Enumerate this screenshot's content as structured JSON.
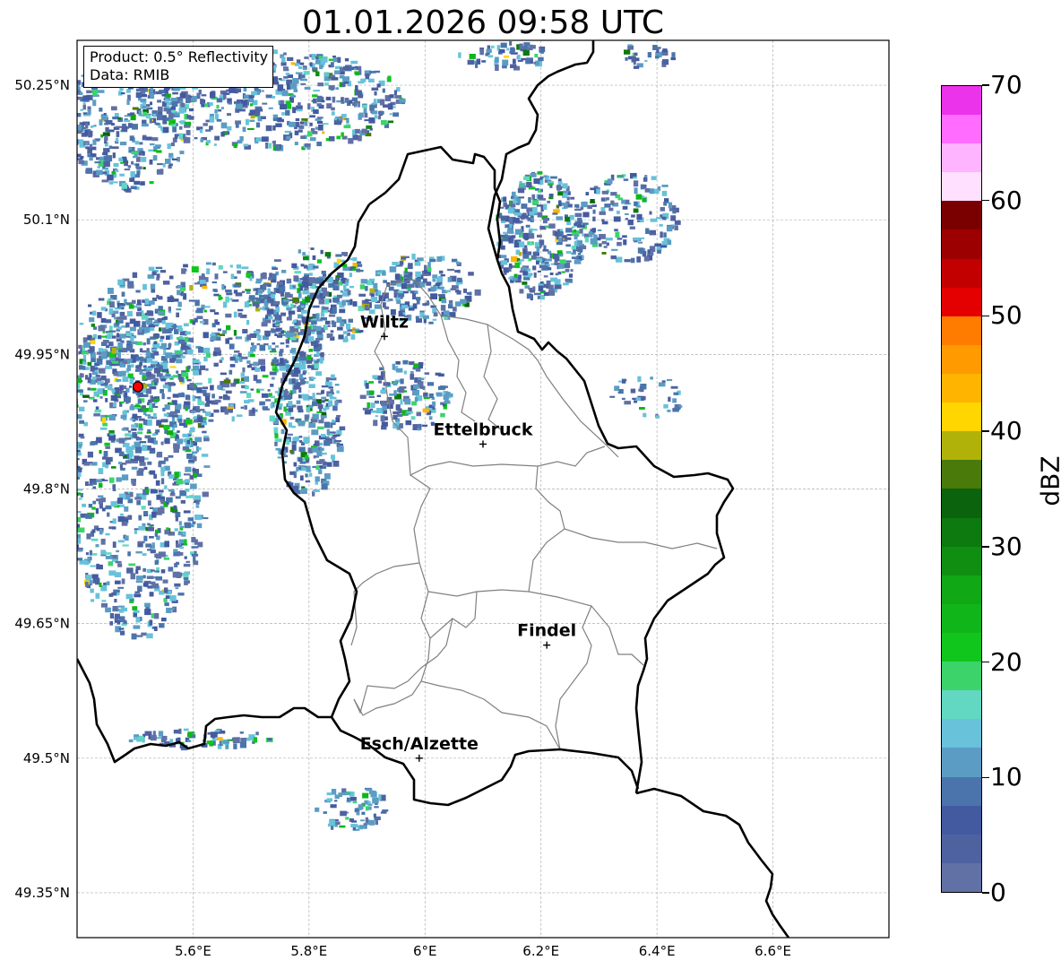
{
  "title": "01.01.2026 09:58 UTC",
  "info": {
    "product": "Product: 0.5° Reflectivity",
    "data": "Data: RMIB"
  },
  "map": {
    "lon_range": [
      5.4,
      6.8
    ],
    "lat_range": [
      49.3,
      50.3
    ],
    "lon_ticks": [
      {
        "value": 5.6,
        "label": "5.6°E"
      },
      {
        "value": 5.8,
        "label": "5.8°E"
      },
      {
        "value": 6.0,
        "label": "6°E"
      },
      {
        "value": 6.2,
        "label": "6.2°E"
      },
      {
        "value": 6.4,
        "label": "6.4°E"
      },
      {
        "value": 6.6,
        "label": "6.6°E"
      }
    ],
    "lat_ticks": [
      {
        "value": 49.35,
        "label": "49.35°N"
      },
      {
        "value": 49.5,
        "label": "49.5°N"
      },
      {
        "value": 49.65,
        "label": "49.65°N"
      },
      {
        "value": 49.8,
        "label": "49.8°N"
      },
      {
        "value": 49.95,
        "label": "49.95°N"
      },
      {
        "value": 50.1,
        "label": "50.1°N"
      },
      {
        "value": 50.25,
        "label": "50.25°N"
      }
    ],
    "grid": true,
    "cities": [
      {
        "name": "Wiltz",
        "lon": 5.93,
        "lat": 49.97
      },
      {
        "name": "Ettelbruck",
        "lon": 6.1,
        "lat": 49.85
      },
      {
        "name": "Findel",
        "lon": 6.21,
        "lat": 49.626
      },
      {
        "name": "Esch/Alzette",
        "lon": 5.99,
        "lat": 49.5
      }
    ],
    "radar_site": {
      "lon": 5.505,
      "lat": 49.914,
      "color": "#ff0000"
    }
  },
  "colorbar": {
    "label": "dBZ",
    "min": 0,
    "max": 70,
    "step": 2.5,
    "ticks": [
      0,
      10,
      20,
      30,
      40,
      50,
      60,
      70
    ],
    "colors": [
      "#6171a6",
      "#4f62a0",
      "#435aa0",
      "#4a74ab",
      "#5b9cc4",
      "#67c2da",
      "#62d7c2",
      "#3cd46a",
      "#10c61c",
      "#10b619",
      "#10a814",
      "#0f8e12",
      "#0c7a0e",
      "#0b640d",
      "#497a0a",
      "#b0b20a",
      "#ffd600",
      "#ffb400",
      "#ff9a00",
      "#ff7c00",
      "#e40000",
      "#c20000",
      "#9c0000",
      "#7a0000",
      "#ffe0ff",
      "#ffb4ff",
      "#ff6cff",
      "#ea33ea"
    ]
  }
}
